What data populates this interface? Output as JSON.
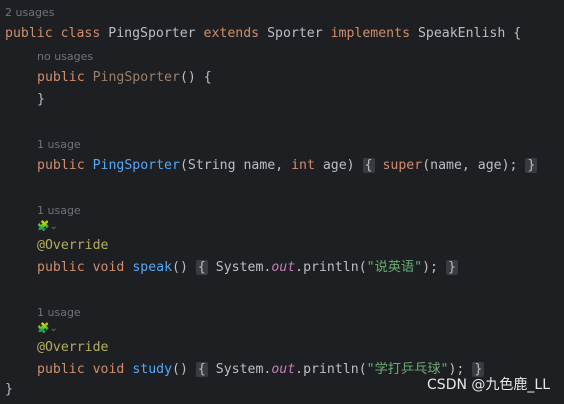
{
  "hints": {
    "class_usages": "2 usages",
    "ctor1_usages": "no usages",
    "ctor2_usages": "1 usage",
    "speak_usages": "1 usage",
    "study_usages": "1 usage"
  },
  "code": {
    "class_public": "public",
    "class_kw": "class",
    "class_name": "PingSporter",
    "extends_kw": "extends",
    "super_class": "Sporter",
    "implements_kw": "implements",
    "interface_name": "SpeakEnlish",
    "open_brace": "{",
    "ctor1_public": "public",
    "ctor1_name": "PingSporter",
    "ctor1_parens": "() {",
    "ctor1_close": "}",
    "ctor2_public": "public",
    "ctor2_name": "PingSporter",
    "ctor2_params_a": "(String name, ",
    "ctor2_int": "int",
    "ctor2_params_b": " age)",
    "ctor2_body_open": "{",
    "ctor2_super": "super",
    "ctor2_call": "(name, age);",
    "ctor2_body_close": "}",
    "override1": "@Override",
    "speak_public": "public",
    "speak_void": "void",
    "speak_name": "speak",
    "speak_parens": "()",
    "speak_body_open": "{",
    "speak_sys": "System.",
    "speak_out": "out",
    "speak_println": ".println(",
    "speak_string": "\"说英语\"",
    "speak_end": ");",
    "speak_body_close": "}",
    "override2": "@Override",
    "study_public": "public",
    "study_void": "void",
    "study_name": "study",
    "study_parens": "()",
    "study_body_open": "{",
    "study_sys": "System.",
    "study_out": "out",
    "study_println": ".println(",
    "study_string": "\"学打乒乓球\"",
    "study_end": ");",
    "study_body_close": "}",
    "class_close": "}"
  },
  "gutter": {
    "speak_icon": "override-icon",
    "study_icon": "override-icon"
  },
  "watermark": "CSDN @九色鹿_LL",
  "colors": {
    "background": "#1e1f22",
    "keyword": "#cf8e6d",
    "method": "#56a8f5",
    "annotation": "#b3ae60",
    "string": "#6aab73",
    "static_field": "#c77dbb",
    "hint": "#6f737a"
  }
}
